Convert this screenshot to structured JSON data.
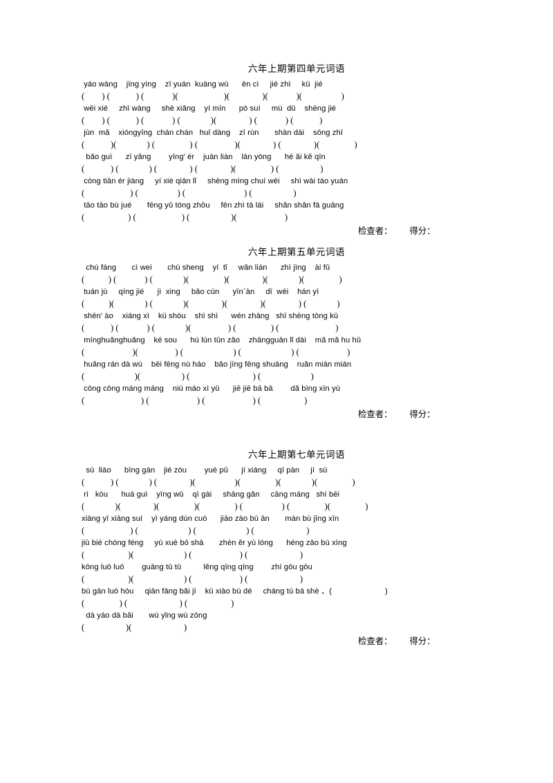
{
  "document": {
    "type": "chinese-pinyin-vocabulary-worksheet",
    "grade_label": "六年上期"
  },
  "sections": [
    {
      "title": "六年上期第四单元词语",
      "lines": [
        {
          "pinyin": " yáo wàng    jīng yíng    zī yuán  kuàng wù      ēn cì     jié zhì     kū  jié",
          "blanks": "(        ) (            ) (             )(                     )(               )(             )(                  )"
        },
        {
          "pinyin": " wēi xié     zhī wàng     shè xiǎng    yí mín      pò suì     mù  dǔ    shèng jié",
          "blanks": "(        ) (            ) (             ) (              )(               ) (             ) (            )"
        },
        {
          "pinyin": " jùn  mǎ    xióngyīng  chán chán   huī dàng    zī rùn       shàn dài    sōng zhī",
          "blanks": "(            )(              ) (                ) (                 )(               ) (               )(                )"
        },
        {
          "pinyin": "  bǎo guì      zī yǎng        yīng′ ér    juàn liàn    làn yòng      hé ǎi kě qīn",
          "blanks": "(            ) (              ) (               ) (               )(                ) (                   )"
        },
        {
          "pinyin": " cóng tiān ér jiàng     yí xiè qiān lǐ     shēng mìng chuí wēi     shì wài táo yuán",
          "blanks": "(                     ) (                  ) (                           ) (                   )"
        },
        {
          "pinyin": " tāo tāo bù jué       fēng yǔ tóng zhōu     fēn zhì tà lái     shǎn shǎn fā guāng",
          "blanks": "(                    ) (                     ) (                   )(                      )"
        }
      ],
      "footer": {
        "checker_label": "检查者：",
        "score_label": "得分："
      }
    },
    {
      "title": "六年上期第五单元词语",
      "lines": [
        {
          "pinyin": "  chú fáng       cì wei       chù sheng    yí  tǐ     wǎn lián      zhì jìng    ài fǔ",
          "blanks": "(           ) (             ) (              )(                )(               )(              )(                )"
        },
        {
          "pinyin": " tuán jù     qíng jié      jì  xing     bǎo cún      yīn`àn     dī  wēi    hán yì",
          "blanks": "(           )(              ) (              )(               )(               )(               ) (              )"
        },
        {
          "pinyin": " shēn′ ào    xiáng xì    kū shòu    shì shì      wén zhāng   shī shēng tòng kū",
          "blanks": "(            ) (             ) (              )(                 ) (                ) (                          )"
        },
        {
          "pinyin": " mínghuǎnghuǎng    ké sou      hú lún tūn zǎo    zhāngguān lǐ dài    mǎ mǎ hu hǔ",
          "blanks": "(                      )(                 ) (                       ) (                       ) (                      )"
        },
        {
          "pinyin": " huǎng rán dà wù    bēi fēng nù háo    bǎo jīng fēng shuāng    ruǎn mián mián",
          "blanks": "(                       )(                   ) (                             ) (                       )"
        },
        {
          "pinyin": " cōng cōng máng máng    niú máo xì yǔ      jiē jiē bā bā        dǎ bìng xīn yù",
          "blanks": "(                          ) (                      ) (                      ) (                    )"
        }
      ],
      "footer": {
        "checker_label": "检查者：",
        "score_label": "得分："
      }
    },
    {
      "title": "六年上期第七单元词语",
      "lines": [
        {
          "pinyin": "  sù  liào      bīng gàn    jié zòu        yuè pǔ      jí xiáng     qī pàn     jí  sù",
          "blanks": "(            ) (              ) (               )(                  )(                )(              )(                )"
        },
        {
          "pinyin": " rì   kòu      huá guì    yīng wǔ    qì gài     shāng gǎn     cāng máng   shí bēi",
          "blanks": "(              )(               )(                )(                ) (                  ) (                )(                )"
        },
        {
          "pinyin": "xiāng yī xiāng suí    yì yáng dùn cuò      jiāo zào bù ān       màn bù jīng xīn",
          "blanks": "(                     ) (                       ) (                       ) (                        )"
        },
        {
          "pinyin": "jiū bié chóng féng     yù xuè bó shā       zhèn ěr yù lóng      héng zāo bú xìng",
          "blanks": "(                    )(                       ) (                      ) (                        )"
        },
        {
          "pinyin": "kōng luō luō        guāng tū tū          lěng qīng qīng        zhí gōu gōu",
          "blanks": "(                    )(                       ) (                      ) (                        )"
        },
        {
          "pinyin": "bù gān luò hòu     qiān fāng bǎi jì    kū xiào bù dé     cháng tú bá shè 、(                        )",
          "blanks": "(                ) (                        ) (                    )"
        },
        {
          "pinyin": "  dà yáo dà bǎi       wú yǐng wú zōng",
          "blanks": "(                   )(                        )"
        }
      ],
      "footer": {
        "checker_label": "检查者：",
        "score_label": "得分："
      }
    }
  ]
}
